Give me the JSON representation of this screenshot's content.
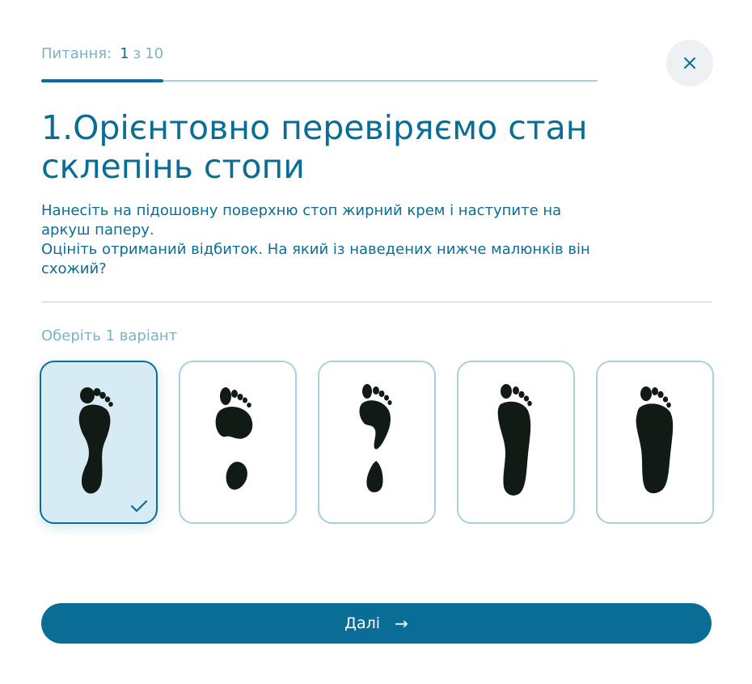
{
  "progress": {
    "label": "Питання:",
    "current": "1",
    "separator": "з",
    "total": "10",
    "fraction": 0.22
  },
  "close_icon": "close-icon",
  "question": {
    "title": "1.Орієнтовно перевіряємо стан склепінь стопи",
    "description_line1": "Нанесіть на підошовну поверхню стоп жирний крем і наступите на аркуш паперу.",
    "description_line2": "Оцініть отриманий відбиток. На який із наведених нижче малюнків він схожий?"
  },
  "choice_hint": "Оберіть 1 варіант",
  "options": [
    {
      "id": "option-1",
      "selected": true
    },
    {
      "id": "option-2",
      "selected": false
    },
    {
      "id": "option-3",
      "selected": false
    },
    {
      "id": "option-4",
      "selected": false
    },
    {
      "id": "option-5",
      "selected": false
    }
  ],
  "next_button": {
    "label": "Далі",
    "arrow": "→"
  },
  "colors": {
    "accent": "#0a6d96",
    "muted": "#7ab3c9",
    "selected_bg": "#d6ebf4"
  }
}
